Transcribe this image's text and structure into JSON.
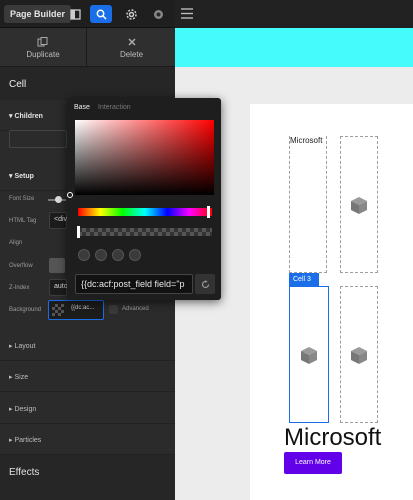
{
  "toolbar": {
    "brand": "Page Builder",
    "icons": [
      "panel-icon",
      "search-icon",
      "gear-icon",
      "eye-icon",
      "hamburger-icon"
    ]
  },
  "actions": {
    "duplicate": "Duplicate",
    "delete": "Delete"
  },
  "panel": {
    "title": "Cell",
    "children_label": "Children",
    "setup_label": "Setup",
    "fields": {
      "font_size": "Font Size",
      "html_tag": "HTML Tag",
      "html_tag_value": "<div",
      "align": "Align",
      "overflow": "Overflow",
      "z_index": "Z-Index",
      "z_index_value": "auto",
      "background": "Background",
      "background_value": "{{dc:ac...",
      "advanced": "Advanced"
    },
    "sections": [
      "Layout",
      "Size",
      "Design",
      "Particles"
    ],
    "effects": "Effects"
  },
  "picker": {
    "tabs": [
      "Base",
      "Interaction"
    ],
    "hex_value": "{{dc:acf:post_field field=\"p"
  },
  "canvas": {
    "cell_tag": "Cell 3",
    "small_title": "Microsoft",
    "big_title": "Microsoft",
    "button": "Learn More"
  },
  "colors": {
    "accent": "#1a6fe8",
    "cyan": "#45fbfb",
    "button": "#6200ea"
  }
}
